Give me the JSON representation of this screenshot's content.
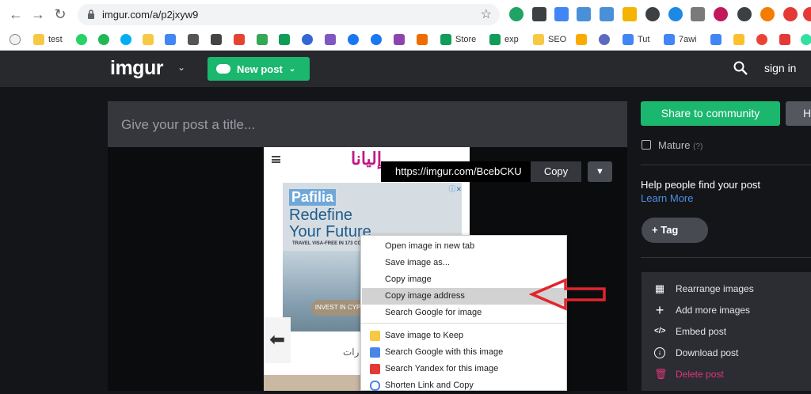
{
  "browser": {
    "url": "imgur.com/a/p2jxyw9",
    "bookmarks": [
      {
        "label": "test",
        "color": "#f7c843"
      },
      {
        "label": "Store",
        "color": "#0f9d58"
      },
      {
        "label": "exp",
        "color": "#0f9d58"
      },
      {
        "label": "SEO",
        "color": "#f7c843"
      },
      {
        "label": "Tut",
        "color": "#4285f4"
      },
      {
        "label": "7awi",
        "color": "#4285f4"
      }
    ]
  },
  "header": {
    "logo": "imgur",
    "new_post": "New post",
    "sign_in": "sign in"
  },
  "post": {
    "title_placeholder": "Give your post a title..."
  },
  "image": {
    "arabic_banner": "إليانا",
    "ad_brand": "Pafilia",
    "ad_line1": "Redefine",
    "ad_line2": "Your Future",
    "ad_small": "TRAVEL VISA-FREE IN 173 CO",
    "ad_button": "INVEST IN CYPRUS",
    "arabic_caption": "رات"
  },
  "share_link": {
    "url": "https://imgur.com/BcebCKU",
    "copy": "Copy"
  },
  "context_menu": {
    "items": [
      "Open image in new tab",
      "Save image as...",
      "Copy image",
      "Copy image address",
      "Search Google for image",
      "Save image to Keep",
      "Search Google with this image",
      "Search Yandex for this image",
      "Shorten Link and Copy"
    ],
    "highlighted_index": 3
  },
  "sidebar": {
    "share_button": "Share to community",
    "hidden_button_partial": "H",
    "mature_label": "Mature",
    "mature_hint": "(?)",
    "help_text": "Help people find your post",
    "learn_more": "Learn More",
    "tag_button": "Tag",
    "actions": [
      "Rearrange images",
      "Add more images",
      "Embed post",
      "Download post",
      "Delete post"
    ]
  },
  "colors": {
    "imgur_green": "#1bb76e",
    "highlight_arrow": "#e0252f",
    "delete_pink": "#e1367a",
    "link_blue": "#4d8ee6"
  }
}
